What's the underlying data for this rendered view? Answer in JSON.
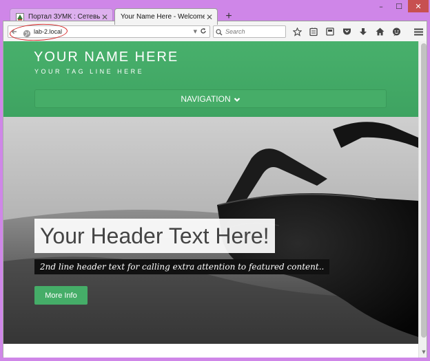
{
  "browser": {
    "tabs": [
      {
        "title": "Портал ЗУМК : Сетевые ...",
        "active": false,
        "favicon": "portal-favicon"
      },
      {
        "title": "Your Name Here - Welcome",
        "active": true,
        "favicon": "none"
      }
    ],
    "new_tab_label": "+",
    "window_controls": {
      "minimize": "–",
      "maximize": "☐",
      "close": "✕"
    },
    "url": "lab-2.local",
    "search_placeholder": "Search",
    "toolbar_icons": [
      "star-icon",
      "reading-list-icon",
      "pocket-save-icon",
      "pocket-icon",
      "download-icon",
      "home-icon",
      "chat-icon",
      "menu-icon"
    ]
  },
  "site": {
    "name": "YOUR NAME HERE",
    "tagline": "YOUR TAG LINE HERE",
    "nav_label": "NAVIGATION",
    "hero": {
      "title": "Your Header Text Here!",
      "subtitle": "2nd line header text for calling extra attention to featured content..",
      "button_label": "More Info"
    }
  },
  "colors": {
    "header_green": "#45ad68",
    "window_frame": "#cf86e8",
    "annotation_red": "#d42020"
  }
}
